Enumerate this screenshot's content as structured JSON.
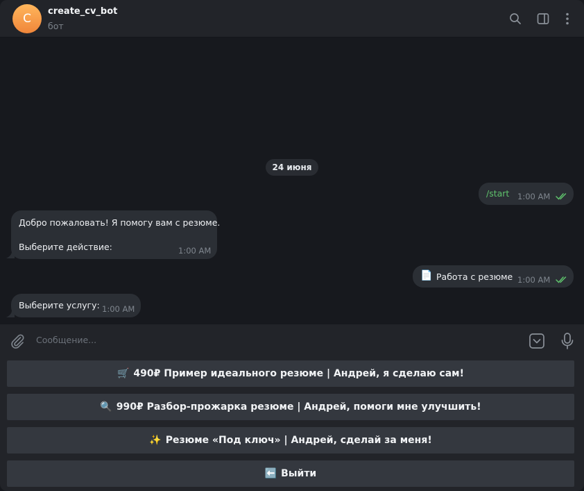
{
  "header": {
    "avatar_letter": "C",
    "title": "create_cv_bot",
    "subtitle": "бот",
    "icons": [
      "search-icon",
      "side-panel-icon",
      "more-icon"
    ]
  },
  "chat": {
    "date": "24 июня",
    "messages": [
      {
        "direction": "out",
        "text": "/start",
        "time": "1:00 AM",
        "status": "read"
      },
      {
        "direction": "in",
        "line1": "Добро пожаловать! Я помогу вам с резюме.",
        "line2": "Выберите действие:",
        "time": "1:00 AM"
      },
      {
        "direction": "out",
        "emoji": "📄",
        "text": "Работа с резюме",
        "time": "1:00 AM",
        "status": "read"
      },
      {
        "direction": "in",
        "text": "Выберите услугу:",
        "time": "1:00 AM"
      }
    ]
  },
  "input": {
    "placeholder": "Сообщение...",
    "icons": [
      "attach-icon",
      "keyboard-toggle-icon",
      "microphone-icon"
    ]
  },
  "keyboard": {
    "buttons": [
      {
        "emoji": "🛒",
        "label": "490₽ Пример идеального резюме | Андрей, я сделаю сам!"
      },
      {
        "emoji": "🔍",
        "label": "990₽ Разбор-прожарка резюме | Андрей, помоги мне улучшить!"
      },
      {
        "emoji": "✨",
        "label": "Резюме «Под ключ» | Андрей, сделай за меня!"
      },
      {
        "emoji": "⬅️",
        "label": "Выйти"
      }
    ]
  },
  "colors": {
    "accent_green": "#5fc26c",
    "bubble": "#2b2f35",
    "background": "#17191e",
    "panel": "#222429"
  }
}
